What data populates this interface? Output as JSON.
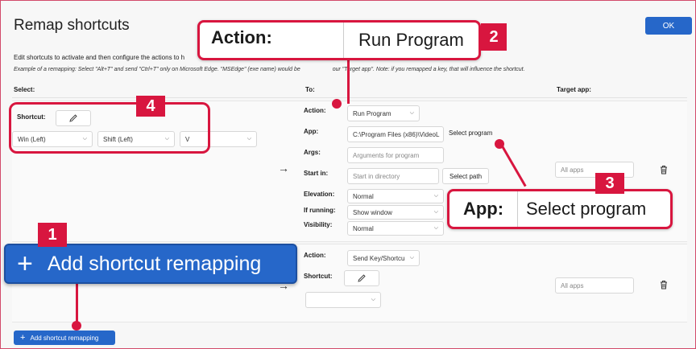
{
  "title": "Remap shortcuts",
  "ok_label": "OK",
  "description": "Edit shortcuts to activate and then configure the actions to h",
  "example": "Example of a remapping: Select \"Alt+T\" and send \"Ctrl+T\" only on Microsoft Edge. \"MSEdge\" (exe name) would be",
  "example_tail": "our \"Target app\". Note: if you remapped a key, that will influence the shortcut.",
  "columns": {
    "select": "Select:",
    "to": "To:",
    "target": "Target app:"
  },
  "row1": {
    "shortcut_label": "Shortcut:",
    "keys": [
      "Win (Left)",
      "Shift (Left)",
      "V",
      ""
    ],
    "action_label": "Action:",
    "action_value": "Run Program",
    "app_label": "App:",
    "app_value": "C:\\Program Files (x86)\\VideoL",
    "select_program": "Select program",
    "args_label": "Args:",
    "args_placeholder": "Arguments for program",
    "startin_label": "Start in:",
    "startin_placeholder": "Start in directory",
    "select_path": "Select path",
    "elevation_label": "Elevation:",
    "elevation_value": "Normal",
    "ifrunning_label": "If running:",
    "ifrunning_value": "Show window",
    "visibility_label": "Visibility:",
    "visibility_value": "Normal",
    "target_placeholder": "All apps"
  },
  "row2": {
    "action_label": "Action:",
    "action_value": "Send Key/Shortcu",
    "shortcut_label": "Shortcut:",
    "target_placeholder": "All apps"
  },
  "add_button": "Add shortcut remapping",
  "callouts": {
    "c1": {
      "number": "1",
      "text": "Add shortcut remapping"
    },
    "c2": {
      "number": "2",
      "label": "Action:",
      "value": "Run Program"
    },
    "c3": {
      "number": "3",
      "label": "App:",
      "value": "Select program"
    },
    "c4": {
      "number": "4"
    }
  },
  "colors": {
    "accent": "#2667c9",
    "callout": "#d8163f"
  },
  "icons": [
    "pencil-icon",
    "arrow-right-icon",
    "trash-icon",
    "plus-icon",
    "chevron-down-icon"
  ]
}
